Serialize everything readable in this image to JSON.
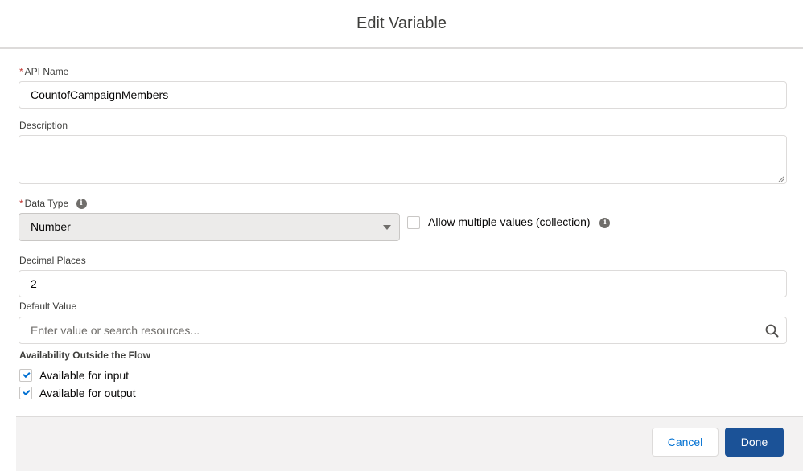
{
  "modal": {
    "title": "Edit Variable"
  },
  "fields": {
    "api_name": {
      "label": "API Name",
      "required_marker": "*",
      "value": "CountofCampaignMembers"
    },
    "description": {
      "label": "Description",
      "value": ""
    },
    "data_type": {
      "label": "Data Type",
      "required_marker": "*",
      "info_icon": "info-icon",
      "selected": "Number"
    },
    "allow_multiple": {
      "label": "Allow multiple values (collection)",
      "checked": false,
      "info_icon": "info-icon"
    },
    "decimal_places": {
      "label": "Decimal Places",
      "value": "2"
    },
    "default_value": {
      "label": "Default Value",
      "placeholder": "Enter value or search resources...",
      "icon": "search-icon"
    }
  },
  "availability": {
    "title": "Availability Outside the Flow",
    "options": [
      {
        "label": "Available for input",
        "checked": true
      },
      {
        "label": "Available for output",
        "checked": true
      }
    ]
  },
  "footer": {
    "cancel_label": "Cancel",
    "done_label": "Done"
  },
  "colors": {
    "brand": "#1b5297",
    "link": "#0070d2",
    "required": "#c23934",
    "footer_bg": "#f3f2f2"
  }
}
